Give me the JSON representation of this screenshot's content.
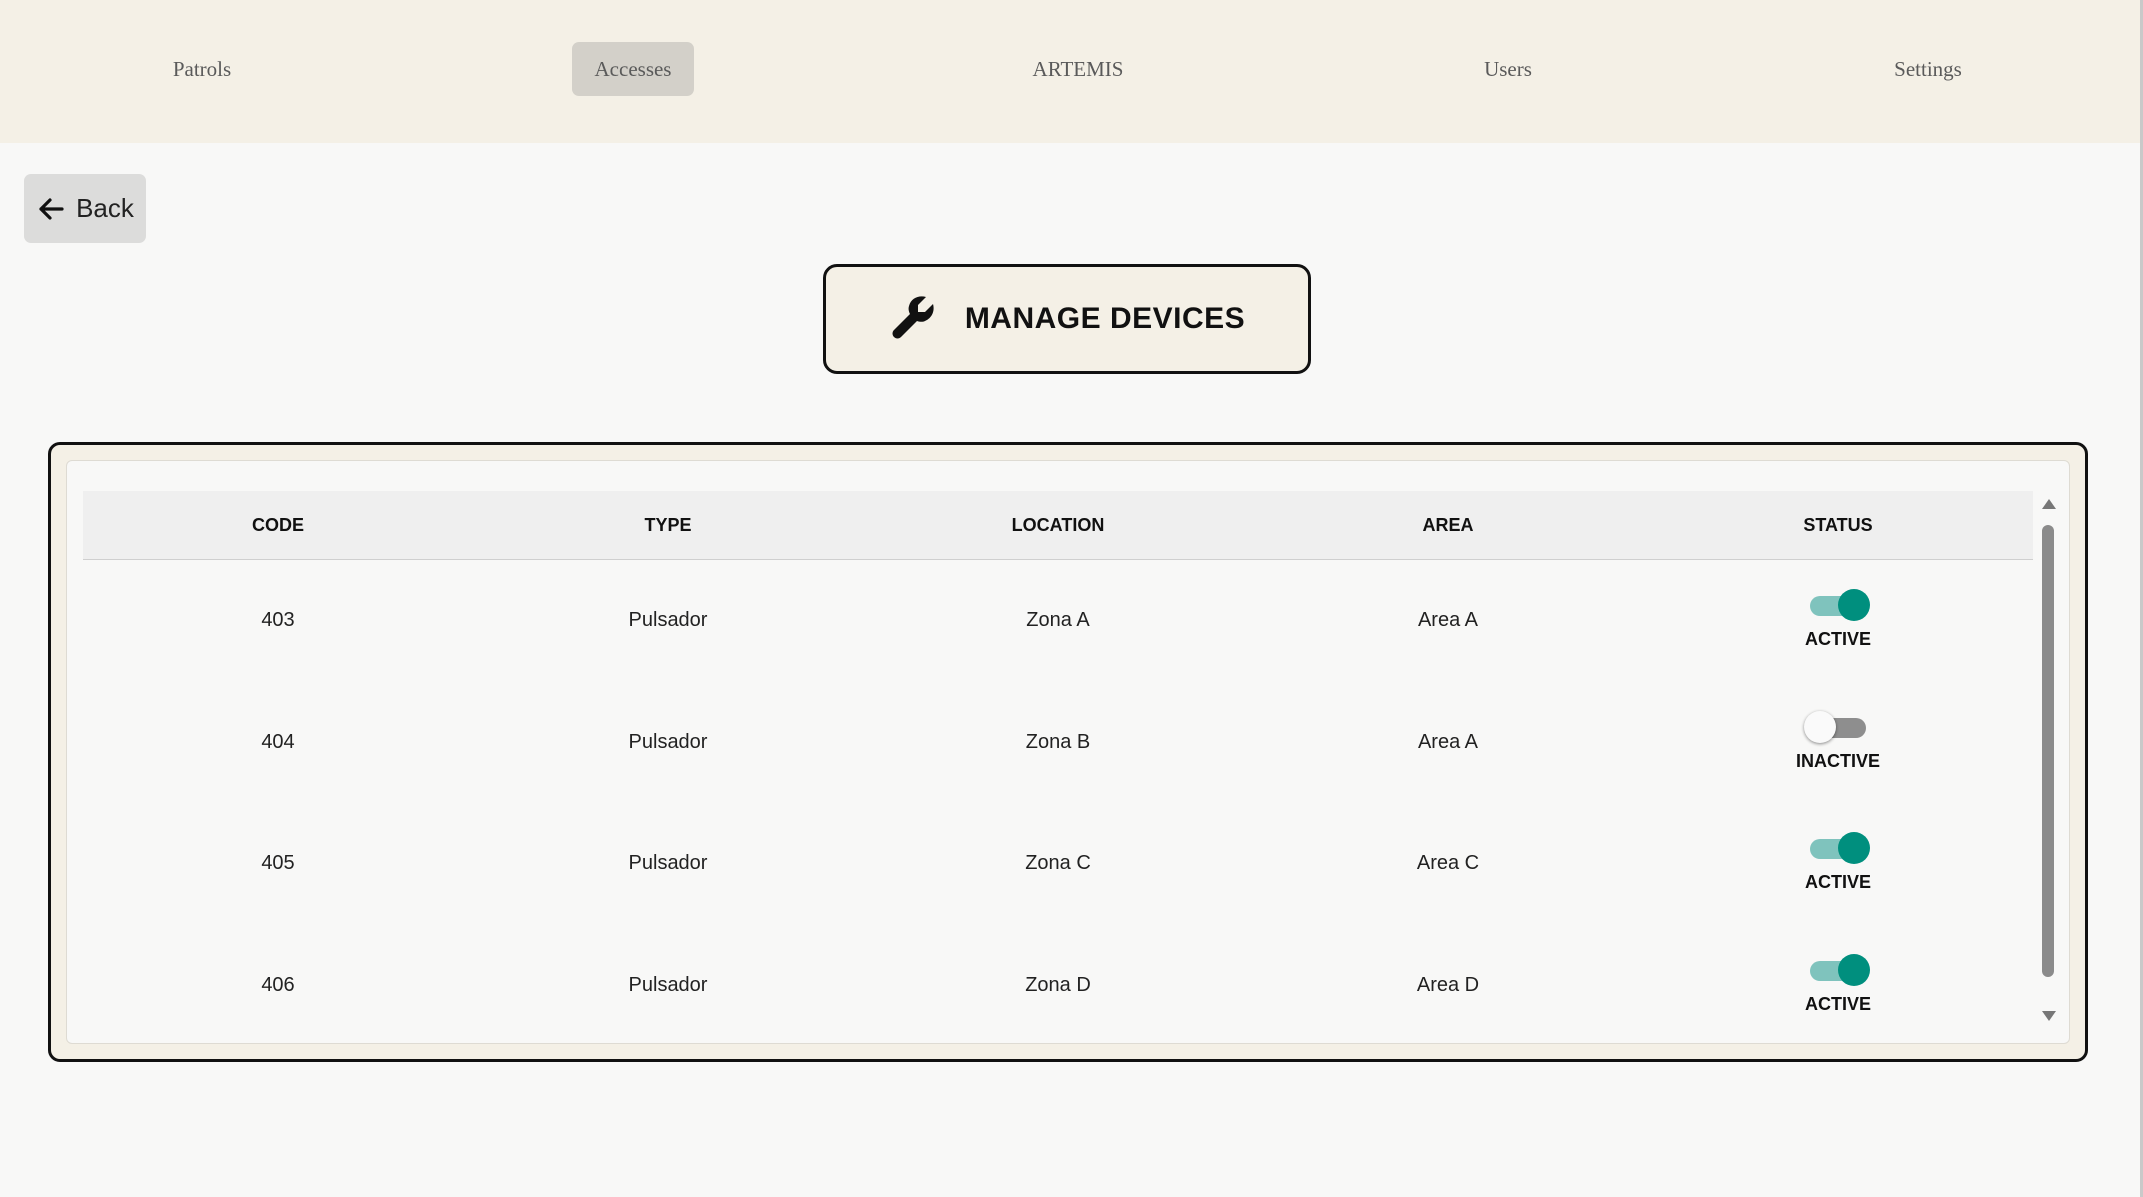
{
  "nav": {
    "items": [
      {
        "label": "Patrols",
        "active": false
      },
      {
        "label": "Accesses",
        "active": true
      },
      {
        "label": "ARTEMIS",
        "active": false
      },
      {
        "label": "Users",
        "active": false
      },
      {
        "label": "Settings",
        "active": false
      }
    ]
  },
  "back": {
    "label": "Back",
    "icon": "arrow-left-icon"
  },
  "title": {
    "text": "MANAGE DEVICES",
    "icon": "wrench-icon"
  },
  "table": {
    "headers": [
      "CODE",
      "TYPE",
      "LOCATION",
      "AREA",
      "STATUS"
    ],
    "rows": [
      {
        "code": "403",
        "type": "Pulsador",
        "location": "Zona A",
        "area": "Area A",
        "status": "ACTIVE",
        "on": true
      },
      {
        "code": "404",
        "type": "Pulsador",
        "location": "Zona B",
        "area": "Area A",
        "status": "INACTIVE",
        "on": false
      },
      {
        "code": "405",
        "type": "Pulsador",
        "location": "Zona C",
        "area": "Area C",
        "status": "ACTIVE",
        "on": true
      },
      {
        "code": "406",
        "type": "Pulsador",
        "location": "Zona D",
        "area": "Area D",
        "status": "ACTIVE",
        "on": true
      }
    ]
  },
  "colors": {
    "nav_bg": "#f4f0e6",
    "nav_active_bg": "#d3d0c9",
    "toggle_on": "#008f7e",
    "toggle_on_track": "#7fc3bd",
    "toggle_off_track": "#8e8e8e"
  }
}
